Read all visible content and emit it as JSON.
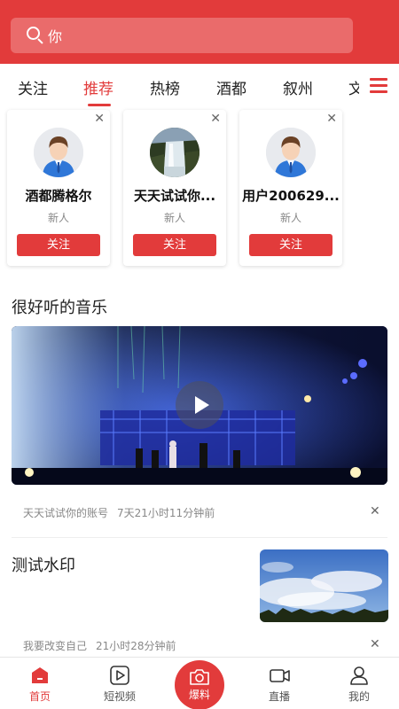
{
  "search": {
    "text": "你"
  },
  "tabs": [
    {
      "label": "关注"
    },
    {
      "label": "推荐"
    },
    {
      "label": "热榜"
    },
    {
      "label": "酒都"
    },
    {
      "label": "叙州"
    },
    {
      "label": "文"
    }
  ],
  "active_tab": "推荐",
  "recommend_users": [
    {
      "name": "酒都腾格尔",
      "tag": "新人",
      "button": "关注",
      "avatar": "default-avatar"
    },
    {
      "name": "天天试试你...",
      "tag": "新人",
      "button": "关注",
      "avatar": "waterfall-photo"
    },
    {
      "name": "用户200629...",
      "tag": "新人",
      "button": "关注",
      "avatar": "default-avatar"
    }
  ],
  "posts": [
    {
      "title": "很好听的音乐",
      "author": "天天试试你的账号",
      "time": "7天21小时11分钟前",
      "media": "video"
    },
    {
      "title": "测试水印",
      "author": "我要改变自己",
      "time": "21小时28分钟前",
      "media": "image"
    }
  ],
  "bottom_nav": [
    {
      "label": "首页",
      "icon": "home-icon"
    },
    {
      "label": "短视频",
      "icon": "play-icon"
    },
    {
      "label": "爆料",
      "icon": "camera-icon"
    },
    {
      "label": "直播",
      "icon": "video-camera-icon"
    },
    {
      "label": "我的",
      "icon": "user-icon"
    }
  ],
  "colors": {
    "brand": "#e23b3b",
    "search_bg": "#ea6b6b"
  }
}
